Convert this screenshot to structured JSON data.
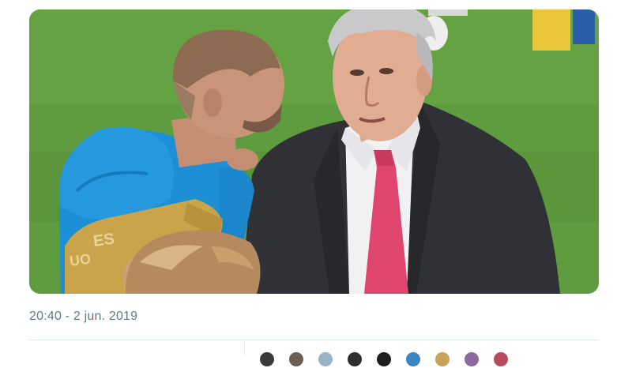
{
  "tweet": {
    "timestamp": "20:40 - 2 jun. 2019",
    "photo_caption_text": "ES",
    "photo_caption_text_2": "UO"
  },
  "likers": [
    {
      "name": "liker-avatar-1",
      "color": "#3b3b3b"
    },
    {
      "name": "liker-avatar-2",
      "color": "#6b5e55"
    },
    {
      "name": "liker-avatar-3",
      "color": "#9bb3c5"
    },
    {
      "name": "liker-avatar-4",
      "color": "#2f2f2f"
    },
    {
      "name": "liker-avatar-5",
      "color": "#1f1f1f"
    },
    {
      "name": "liker-avatar-6",
      "color": "#3d86c6"
    },
    {
      "name": "liker-avatar-7",
      "color": "#caa25a"
    },
    {
      "name": "liker-avatar-8",
      "color": "#8a6a9a"
    },
    {
      "name": "liker-avatar-9",
      "color": "#b84b5b"
    }
  ],
  "colors": {
    "grass": "#5e9a3e",
    "jacket": "#1c8fd6",
    "suit": "#2e3035",
    "tie": "#e0456e",
    "bib": "#c9a44a",
    "timestamp": "#657786"
  }
}
